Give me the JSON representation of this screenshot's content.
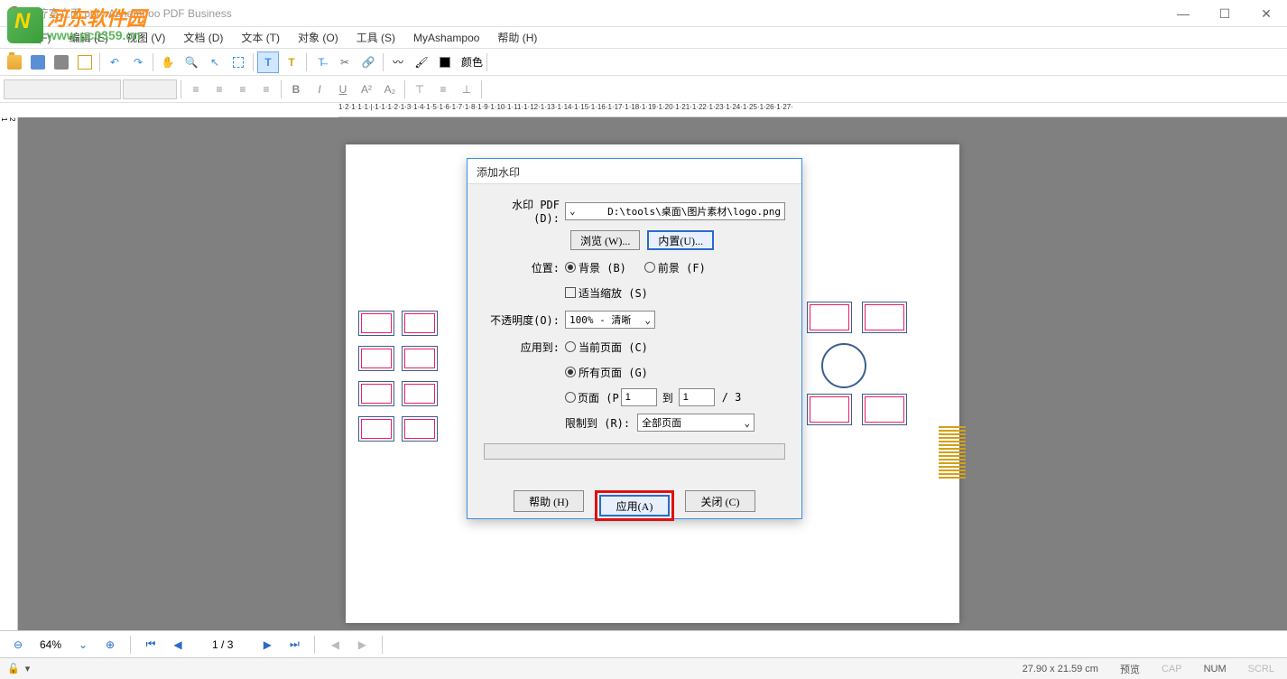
{
  "window": {
    "title": "医疗室立面.pdf - Ashampoo PDF Business",
    "minimize": "—",
    "maximize": "☐",
    "close": "✕"
  },
  "watermark_overlay": {
    "site_name_cn": "河东软件园",
    "site_url": "www.pc0359.cn"
  },
  "menu": {
    "file": "文件 (F)",
    "edit": "编辑 (E)",
    "view": "视图 (V)",
    "document": "文档 (D)",
    "text": "文本 (T)",
    "object": "对象 (O)",
    "tools": "工具 (S)",
    "myashampoo": "MyAshampoo",
    "help": "帮助 (H)"
  },
  "toolbar": {
    "color_label": "颜色"
  },
  "ruler_h": "1·2·1·1·1·|·1·1·1·2·1·3·1·4·1·5·1·6·1·7·1·8·1·9·1·10·1·11·1·12·1·13·1·14·1·15·1·16·1·17·1·18·1·19·1·20·1·21·1·22·1·23·1·24·1·25·1·26·1·27·",
  "dialog": {
    "title": "添加水印",
    "pdf_label": "水印 PDF (D):",
    "pdf_path": "D:\\tools\\桌面\\图片素材\\logo.png",
    "browse_btn": "浏览 (W)...",
    "builtin_btn": "内置(U)...",
    "position_label": "位置:",
    "position_bg": "背景 (B)",
    "position_fg": "前景 (F)",
    "scale_fit": "适当缩放 (S)",
    "opacity_label": "不透明度(O):",
    "opacity_value": "100% - 清晰",
    "apply_to_label": "应用到:",
    "apply_current": "当前页面 (C)",
    "apply_all": "所有页面 (G)",
    "apply_pages": "页面 (P",
    "page_from": "1",
    "page_to_label": "到",
    "page_to": "1",
    "page_total": "/ 3",
    "restrict_label": "限制到 (R):",
    "restrict_value": "全部页面",
    "help_btn": "帮助 (H)",
    "apply_btn": "应用(A)",
    "close_btn": "关闭 (C)"
  },
  "navbar": {
    "zoom": "64%",
    "page_info": "1 / 3"
  },
  "statusbar": {
    "coords": "27.90 x 21.59 cm",
    "preview": "预览",
    "cap": "CAP",
    "num": "NUM",
    "scrl": "SCRL"
  }
}
